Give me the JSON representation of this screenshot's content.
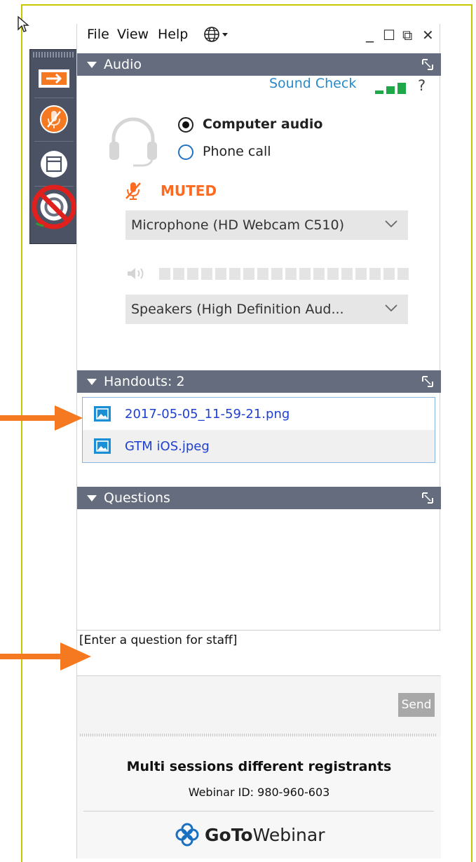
{
  "menu": {
    "file": "File",
    "view": "View",
    "help": "Help",
    "globe_icon": "globe-icon",
    "window_controls": {
      "minimize": "_",
      "restore": "☐",
      "popout": "⧉",
      "close": "✕"
    }
  },
  "audio_panel": {
    "title": "Audio",
    "sound_check": "Sound Check",
    "help_glyph": "?",
    "options": [
      {
        "label": "Computer audio",
        "selected": true
      },
      {
        "label": "Phone call",
        "selected": false
      }
    ],
    "mute_status": "MUTED",
    "microphone": "Microphone (HD Webcam C510)",
    "speakers": "Speakers (High Definition Aud...",
    "signal_bars_lit": 3,
    "speaker_level_segments": 12,
    "colors": {
      "muted": "#ff6a21",
      "link": "#2789c9",
      "signal": "#1ea84a"
    }
  },
  "handouts_panel": {
    "title": "Handouts: 2",
    "items": [
      {
        "name": "2017-05-05_11-59-21.png"
      },
      {
        "name": "GTM iOS.jpeg"
      }
    ]
  },
  "questions_panel": {
    "title": "Questions",
    "input_placeholder": "[Enter a question for staff]",
    "send_label": "Send"
  },
  "footer": {
    "session_title": "Multi sessions different registrants",
    "webinar_id": "Webinar ID: 980-960-603",
    "brand_bold": "GoTo",
    "brand_regular": "Webinar"
  },
  "annotation_color": "#f47920"
}
